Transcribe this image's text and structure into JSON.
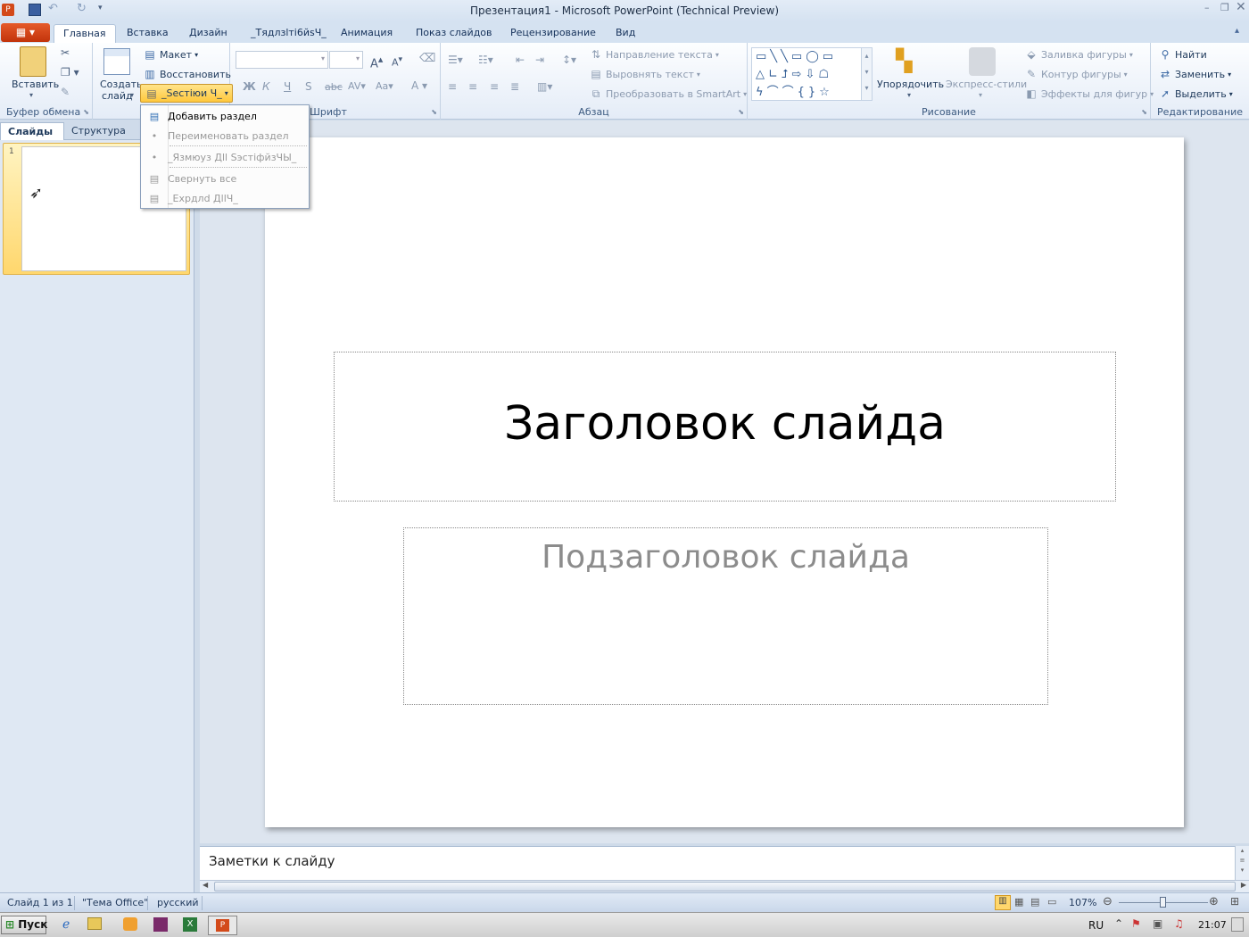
{
  "window": {
    "title": "Презентация1 - Microsoft PowerPoint (Technical Preview)",
    "controls": [
      "minimize-icon",
      "restore-icon",
      "close-icon"
    ]
  },
  "tabs": [
    {
      "label": "Главная",
      "active": true
    },
    {
      "label": "Вставка"
    },
    {
      "label": "Дизайн"
    },
    {
      "label": "_Тядлзlтi6йsЧ_"
    },
    {
      "label": "Анимация"
    },
    {
      "label": "Показ слайдов"
    },
    {
      "label": "Рецензирование"
    },
    {
      "label": "Вид"
    }
  ],
  "ribbon": {
    "clipboard": {
      "paste": "Вставить",
      "group": "Буфер обмена"
    },
    "slides": {
      "create_line1": "Создать",
      "create_line2": "слайд",
      "layout": "Макет",
      "reset": "Восстановить",
      "section": "_Ѕеcтiюи Ч_"
    },
    "font": {
      "group": "Шрифт"
    },
    "paragraph": {
      "text_direction": "Направление текста",
      "align_text": "Выровнять текст",
      "smartart": "Преобразовать в SmartArt",
      "group": "Абзац"
    },
    "drawing": {
      "arrange": "Упорядочить",
      "quick_styles": "Экспресс-стили",
      "fill": "Заливка фигуры",
      "outline": "Контур фигуры",
      "effects": "Эффекты для фигур",
      "group": "Рисование"
    },
    "editing": {
      "find": "Найти",
      "replace": "Заменить",
      "select": "Выделить",
      "group": "Редактирование"
    }
  },
  "section_menu": {
    "items": [
      {
        "label": "Добавить раздел",
        "enabled": true
      },
      {
        "label": "Переименовать раздел",
        "enabled": false
      },
      {
        "label": "_Язмюуз Дll ЅэcтiфйзЧЫ_",
        "enabled": false
      },
      {
        "label": "Свернуть все",
        "enabled": false
      },
      {
        "label": "_Ехрдлd ДllЧ_",
        "enabled": false
      }
    ]
  },
  "left_pane": {
    "tab_slides": "Слайды",
    "tab_outline": "Структура",
    "slide_number": "1"
  },
  "slide": {
    "title": "Заголовок слайда",
    "subtitle": "Подзаголовок слайда"
  },
  "notes": {
    "placeholder": "Заметки к слайду"
  },
  "status": {
    "slide_info": "Слайд 1 из 1",
    "theme": "\"Тема Office\"",
    "language": "русский",
    "zoom": "107%"
  },
  "taskbar": {
    "start": "Пуск",
    "lang": "RU",
    "clock": "21:07"
  }
}
